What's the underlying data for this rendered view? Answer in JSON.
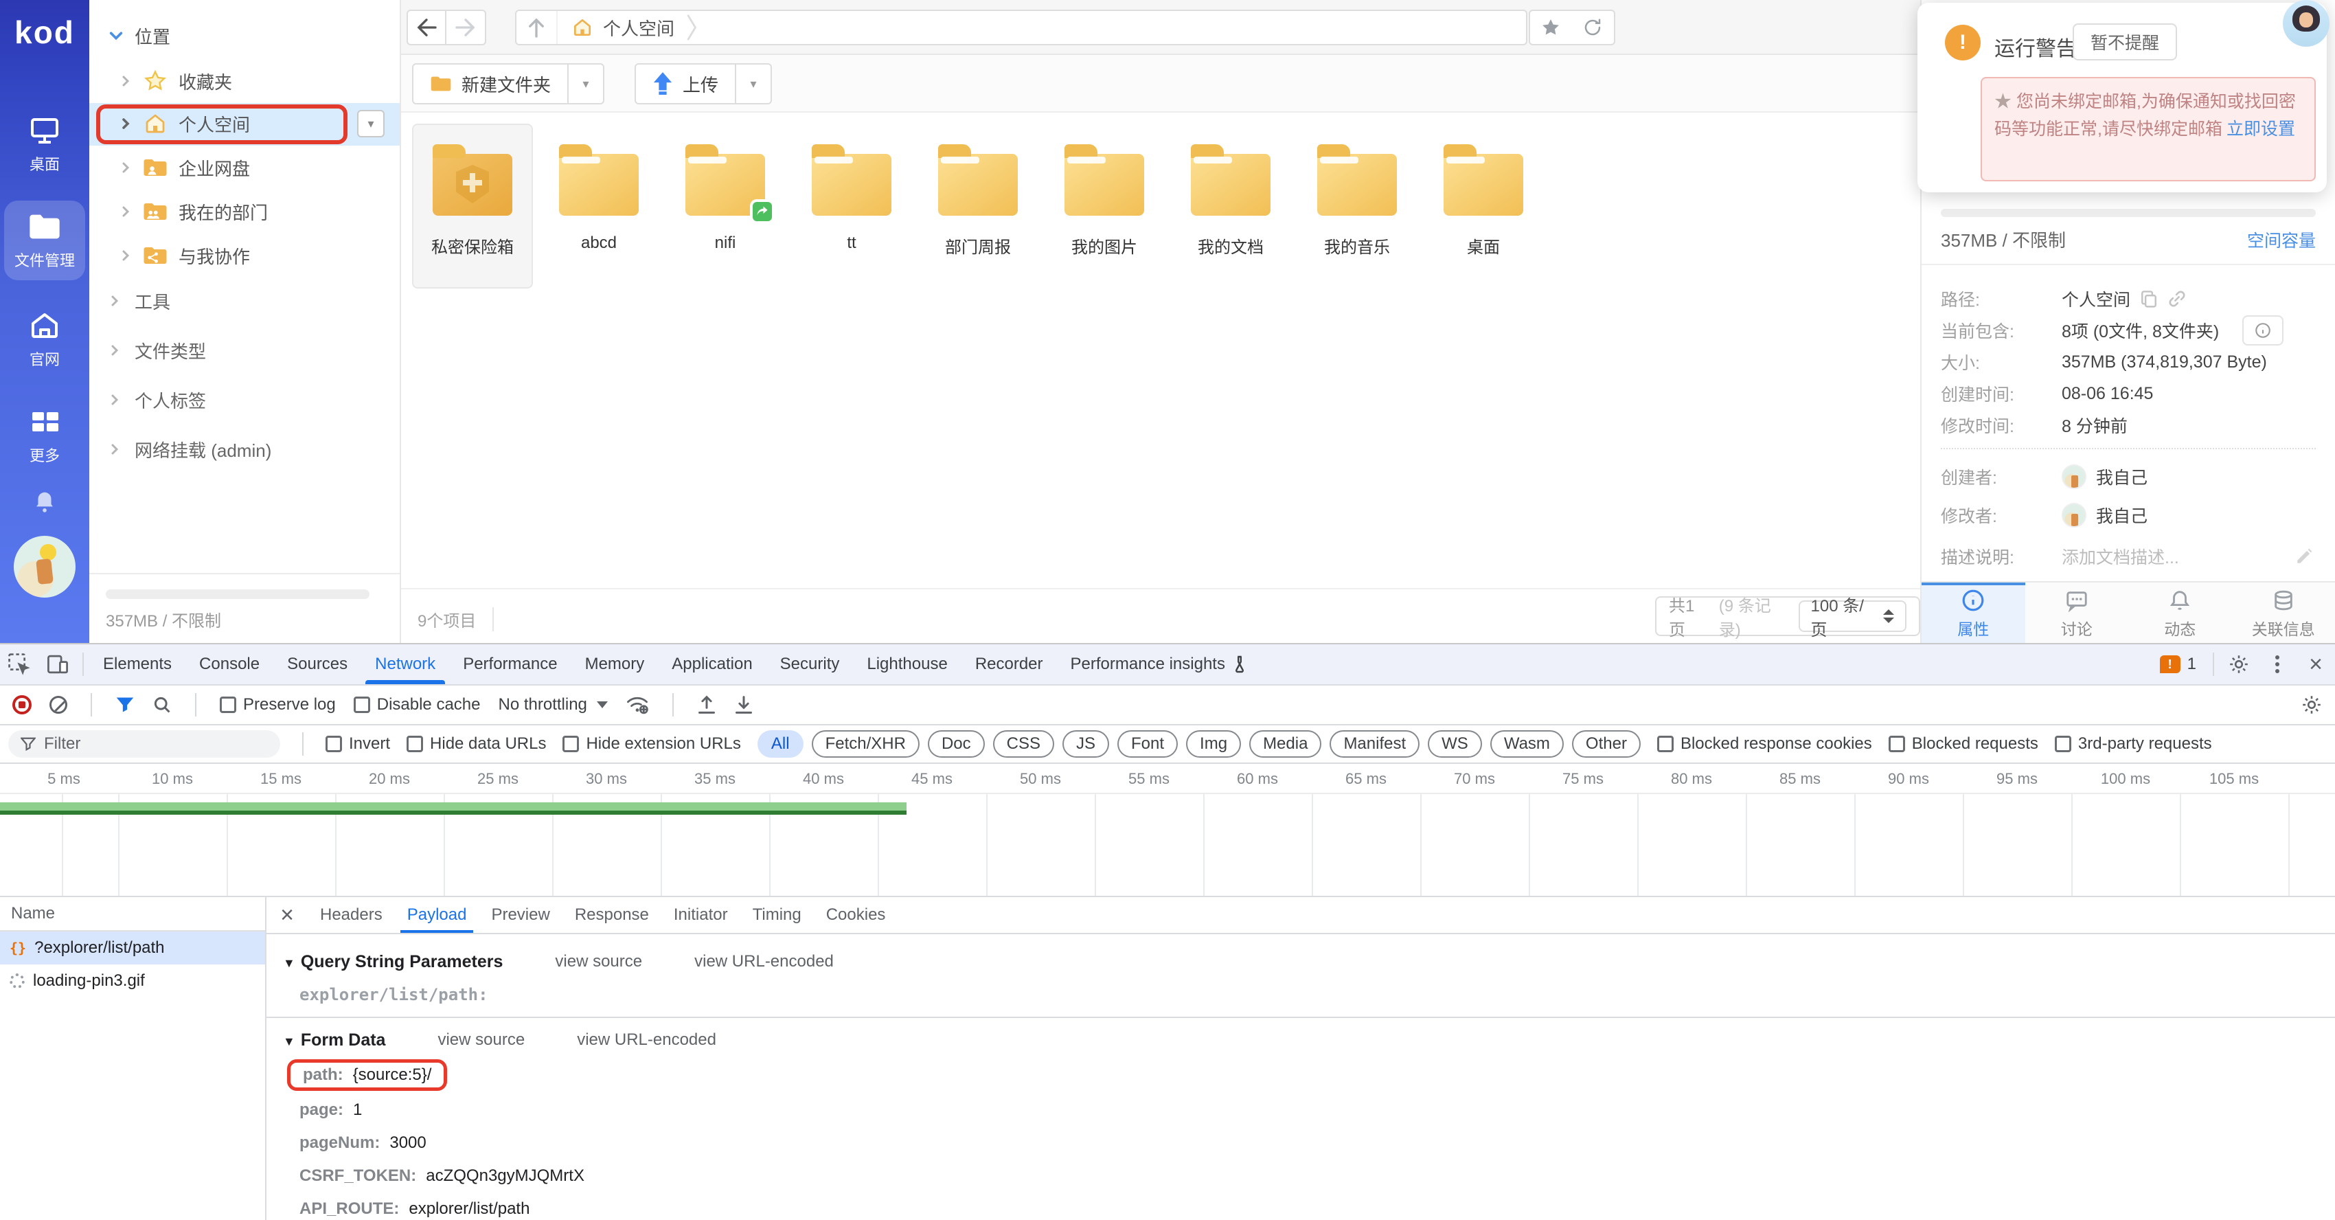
{
  "colors": {
    "accent": "#1a73e8",
    "annotation_red": "#e8392b",
    "rail_blue": "#4a64dc",
    "folder_yellow": "#f2bf55",
    "warning_orange": "#f2a33c",
    "link_blue": "#4a90e2",
    "selected_row": "#d9ecfd",
    "chip_active_bg": "#d3e3fd",
    "green_bar": "#8ecf8e"
  },
  "rail": {
    "logo": "kod",
    "items": [
      {
        "label": "桌面"
      },
      {
        "label": "文件管理"
      },
      {
        "label": "官网"
      },
      {
        "label": "更多"
      }
    ]
  },
  "tree": {
    "section": "位置",
    "items": [
      {
        "label": "收藏夹"
      },
      {
        "label": "个人空间"
      },
      {
        "label": "企业网盘"
      },
      {
        "label": "我在的部门"
      },
      {
        "label": "与我协作"
      }
    ],
    "groups": [
      "工具",
      "文件类型",
      "个人标签",
      "网络挂载 (admin)"
    ],
    "usage": "357MB / 不限制"
  },
  "toolbar": {
    "breadcrumb_home": "个人空间",
    "new_folder": "新建文件夹",
    "upload": "上传"
  },
  "files": {
    "count": "9个项目",
    "items": [
      {
        "name": "私密保险箱"
      },
      {
        "name": "abcd"
      },
      {
        "name": "nifi"
      },
      {
        "name": "tt"
      },
      {
        "name": "部门周报"
      },
      {
        "name": "我的图片"
      },
      {
        "name": "我的文档"
      },
      {
        "name": "我的音乐"
      },
      {
        "name": "桌面"
      }
    ]
  },
  "pagination": {
    "summary": "共1页",
    "records": "(9 条记录)",
    "per_page": "100 条/页"
  },
  "warning": {
    "title": "运行警告",
    "dismiss": "暂不提醒",
    "message": "您尚未绑定邮箱,为确保通知或找回密码等功能正常,请尽快绑定邮箱",
    "link": "立即设置"
  },
  "props": {
    "usage": "357MB / 不限制",
    "quota_link": "空间容量",
    "rows": [
      {
        "label": "路径:",
        "value": "个人空间"
      },
      {
        "label": "当前包含:",
        "value": "8项 (0文件, 8文件夹)"
      },
      {
        "label": "大小:",
        "value": "357MB (374,819,307 Byte)"
      },
      {
        "label": "创建时间:",
        "value": "08-06 16:45"
      },
      {
        "label": "修改时间:",
        "value": "8 分钟前"
      },
      {
        "label": "创建者:",
        "value": "我自己"
      },
      {
        "label": "修改者:",
        "value": "我自己"
      },
      {
        "label": "描述说明:",
        "value": "添加文档描述..."
      }
    ],
    "tabs": [
      {
        "label": "属性"
      },
      {
        "label": "讨论"
      },
      {
        "label": "动态"
      },
      {
        "label": "关联信息"
      }
    ]
  },
  "devtools": {
    "tabs": [
      {
        "label": "Elements"
      },
      {
        "label": "Console"
      },
      {
        "label": "Sources"
      },
      {
        "label": "Network"
      },
      {
        "label": "Performance"
      },
      {
        "label": "Memory"
      },
      {
        "label": "Application"
      },
      {
        "label": "Security"
      },
      {
        "label": "Lighthouse"
      },
      {
        "label": "Recorder"
      },
      {
        "label": "Performance insights"
      }
    ],
    "issues_count": "1",
    "toolbar": {
      "preserve_log": "Preserve log",
      "disable_cache": "Disable cache",
      "throttling": "No throttling"
    },
    "filter": {
      "placeholder": "Filter",
      "invert": "Invert",
      "hide_data": "Hide data URLs",
      "hide_ext": "Hide extension URLs",
      "chips": [
        {
          "label": "All"
        },
        {
          "label": "Fetch/XHR"
        },
        {
          "label": "Doc"
        },
        {
          "label": "CSS"
        },
        {
          "label": "JS"
        },
        {
          "label": "Font"
        },
        {
          "label": "Img"
        },
        {
          "label": "Media"
        },
        {
          "label": "Manifest"
        },
        {
          "label": "WS"
        },
        {
          "label": "Wasm"
        },
        {
          "label": "Other"
        }
      ],
      "more": [
        {
          "label": "Blocked response cookies"
        },
        {
          "label": "Blocked requests"
        },
        {
          "label": "3rd-party requests"
        }
      ]
    },
    "timeline": {
      "ticks": [
        "5 ms",
        "10 ms",
        "15 ms",
        "20 ms",
        "25 ms",
        "30 ms",
        "35 ms",
        "40 ms",
        "45 ms",
        "50 ms",
        "55 ms",
        "60 ms",
        "65 ms",
        "70 ms",
        "75 ms",
        "80 ms",
        "85 ms",
        "90 ms",
        "95 ms",
        "100 ms",
        "105 ms"
      ]
    },
    "requests": {
      "header": "Name",
      "rows": [
        {
          "name": "?explorer/list/path"
        },
        {
          "name": "loading-pin3.gif"
        }
      ]
    },
    "detail": {
      "tabs": [
        {
          "label": "Headers"
        },
        {
          "label": "Payload"
        },
        {
          "label": "Preview"
        },
        {
          "label": "Response"
        },
        {
          "label": "Initiator"
        },
        {
          "label": "Timing"
        },
        {
          "label": "Cookies"
        }
      ],
      "qsp_title": "Query String Parameters",
      "view_source": "view source",
      "view_url": "view URL-encoded",
      "qsp_param": "explorer/list/path:",
      "form_title": "Form Data",
      "params": [
        {
          "key": "path:",
          "value": "{source:5}/"
        },
        {
          "key": "page:",
          "value": "1"
        },
        {
          "key": "pageNum:",
          "value": "3000"
        },
        {
          "key": "CSRF_TOKEN:",
          "value": "acZQQn3gyMJQMrtX"
        },
        {
          "key": "API_ROUTE:",
          "value": "explorer/list/path"
        }
      ]
    }
  }
}
